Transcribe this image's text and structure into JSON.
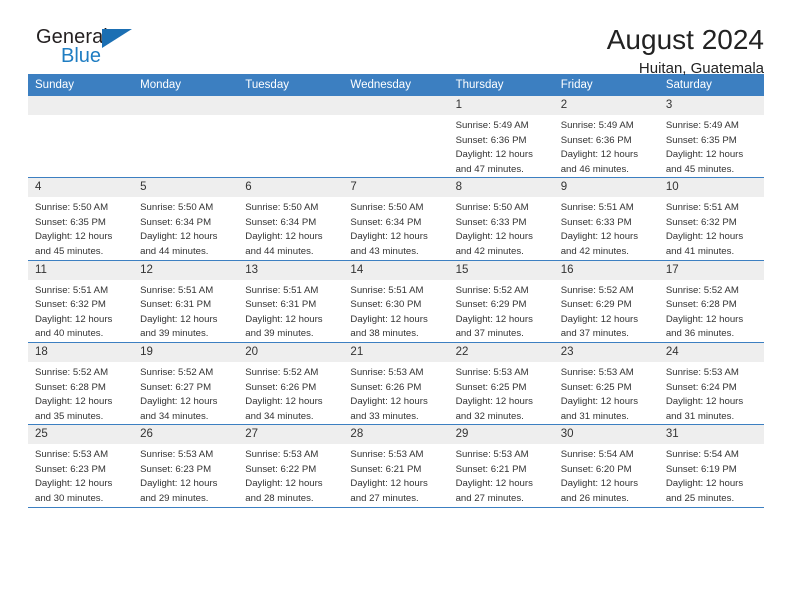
{
  "brand": {
    "word_top": "General",
    "word_bottom": "Blue",
    "triangle_icon": "triangle-logo-icon",
    "color_blue": "#1b6fb3",
    "color_dark": "#231f20"
  },
  "header": {
    "title": "August 2024",
    "subtitle": "Huitan, Guatemala"
  },
  "theme": {
    "header_bar": "#3c7fc1",
    "daynum_bg": "#eeeeee",
    "text": "#333333"
  },
  "weekdays": [
    "Sunday",
    "Monday",
    "Tuesday",
    "Wednesday",
    "Thursday",
    "Friday",
    "Saturday"
  ],
  "labels": {
    "sunrise_prefix": "Sunrise:",
    "sunset_prefix": "Sunset:",
    "daylight_prefix": "Daylight:"
  },
  "weeks": [
    [
      {
        "day": "",
        "empty": true
      },
      {
        "day": "",
        "empty": true
      },
      {
        "day": "",
        "empty": true
      },
      {
        "day": "",
        "empty": true
      },
      {
        "day": "1",
        "sunrise": "Sunrise: 5:49 AM",
        "sunset": "Sunset: 6:36 PM",
        "daylight1": "Daylight: 12 hours",
        "daylight2": "and 47 minutes."
      },
      {
        "day": "2",
        "sunrise": "Sunrise: 5:49 AM",
        "sunset": "Sunset: 6:36 PM",
        "daylight1": "Daylight: 12 hours",
        "daylight2": "and 46 minutes."
      },
      {
        "day": "3",
        "sunrise": "Sunrise: 5:49 AM",
        "sunset": "Sunset: 6:35 PM",
        "daylight1": "Daylight: 12 hours",
        "daylight2": "and 45 minutes."
      }
    ],
    [
      {
        "day": "4",
        "sunrise": "Sunrise: 5:50 AM",
        "sunset": "Sunset: 6:35 PM",
        "daylight1": "Daylight: 12 hours",
        "daylight2": "and 45 minutes."
      },
      {
        "day": "5",
        "sunrise": "Sunrise: 5:50 AM",
        "sunset": "Sunset: 6:34 PM",
        "daylight1": "Daylight: 12 hours",
        "daylight2": "and 44 minutes."
      },
      {
        "day": "6",
        "sunrise": "Sunrise: 5:50 AM",
        "sunset": "Sunset: 6:34 PM",
        "daylight1": "Daylight: 12 hours",
        "daylight2": "and 44 minutes."
      },
      {
        "day": "7",
        "sunrise": "Sunrise: 5:50 AM",
        "sunset": "Sunset: 6:34 PM",
        "daylight1": "Daylight: 12 hours",
        "daylight2": "and 43 minutes."
      },
      {
        "day": "8",
        "sunrise": "Sunrise: 5:50 AM",
        "sunset": "Sunset: 6:33 PM",
        "daylight1": "Daylight: 12 hours",
        "daylight2": "and 42 minutes."
      },
      {
        "day": "9",
        "sunrise": "Sunrise: 5:51 AM",
        "sunset": "Sunset: 6:33 PM",
        "daylight1": "Daylight: 12 hours",
        "daylight2": "and 42 minutes."
      },
      {
        "day": "10",
        "sunrise": "Sunrise: 5:51 AM",
        "sunset": "Sunset: 6:32 PM",
        "daylight1": "Daylight: 12 hours",
        "daylight2": "and 41 minutes."
      }
    ],
    [
      {
        "day": "11",
        "sunrise": "Sunrise: 5:51 AM",
        "sunset": "Sunset: 6:32 PM",
        "daylight1": "Daylight: 12 hours",
        "daylight2": "and 40 minutes."
      },
      {
        "day": "12",
        "sunrise": "Sunrise: 5:51 AM",
        "sunset": "Sunset: 6:31 PM",
        "daylight1": "Daylight: 12 hours",
        "daylight2": "and 39 minutes."
      },
      {
        "day": "13",
        "sunrise": "Sunrise: 5:51 AM",
        "sunset": "Sunset: 6:31 PM",
        "daylight1": "Daylight: 12 hours",
        "daylight2": "and 39 minutes."
      },
      {
        "day": "14",
        "sunrise": "Sunrise: 5:51 AM",
        "sunset": "Sunset: 6:30 PM",
        "daylight1": "Daylight: 12 hours",
        "daylight2": "and 38 minutes."
      },
      {
        "day": "15",
        "sunrise": "Sunrise: 5:52 AM",
        "sunset": "Sunset: 6:29 PM",
        "daylight1": "Daylight: 12 hours",
        "daylight2": "and 37 minutes."
      },
      {
        "day": "16",
        "sunrise": "Sunrise: 5:52 AM",
        "sunset": "Sunset: 6:29 PM",
        "daylight1": "Daylight: 12 hours",
        "daylight2": "and 37 minutes."
      },
      {
        "day": "17",
        "sunrise": "Sunrise: 5:52 AM",
        "sunset": "Sunset: 6:28 PM",
        "daylight1": "Daylight: 12 hours",
        "daylight2": "and 36 minutes."
      }
    ],
    [
      {
        "day": "18",
        "sunrise": "Sunrise: 5:52 AM",
        "sunset": "Sunset: 6:28 PM",
        "daylight1": "Daylight: 12 hours",
        "daylight2": "and 35 minutes."
      },
      {
        "day": "19",
        "sunrise": "Sunrise: 5:52 AM",
        "sunset": "Sunset: 6:27 PM",
        "daylight1": "Daylight: 12 hours",
        "daylight2": "and 34 minutes."
      },
      {
        "day": "20",
        "sunrise": "Sunrise: 5:52 AM",
        "sunset": "Sunset: 6:26 PM",
        "daylight1": "Daylight: 12 hours",
        "daylight2": "and 34 minutes."
      },
      {
        "day": "21",
        "sunrise": "Sunrise: 5:53 AM",
        "sunset": "Sunset: 6:26 PM",
        "daylight1": "Daylight: 12 hours",
        "daylight2": "and 33 minutes."
      },
      {
        "day": "22",
        "sunrise": "Sunrise: 5:53 AM",
        "sunset": "Sunset: 6:25 PM",
        "daylight1": "Daylight: 12 hours",
        "daylight2": "and 32 minutes."
      },
      {
        "day": "23",
        "sunrise": "Sunrise: 5:53 AM",
        "sunset": "Sunset: 6:25 PM",
        "daylight1": "Daylight: 12 hours",
        "daylight2": "and 31 minutes."
      },
      {
        "day": "24",
        "sunrise": "Sunrise: 5:53 AM",
        "sunset": "Sunset: 6:24 PM",
        "daylight1": "Daylight: 12 hours",
        "daylight2": "and 31 minutes."
      }
    ],
    [
      {
        "day": "25",
        "sunrise": "Sunrise: 5:53 AM",
        "sunset": "Sunset: 6:23 PM",
        "daylight1": "Daylight: 12 hours",
        "daylight2": "and 30 minutes."
      },
      {
        "day": "26",
        "sunrise": "Sunrise: 5:53 AM",
        "sunset": "Sunset: 6:23 PM",
        "daylight1": "Daylight: 12 hours",
        "daylight2": "and 29 minutes."
      },
      {
        "day": "27",
        "sunrise": "Sunrise: 5:53 AM",
        "sunset": "Sunset: 6:22 PM",
        "daylight1": "Daylight: 12 hours",
        "daylight2": "and 28 minutes."
      },
      {
        "day": "28",
        "sunrise": "Sunrise: 5:53 AM",
        "sunset": "Sunset: 6:21 PM",
        "daylight1": "Daylight: 12 hours",
        "daylight2": "and 27 minutes."
      },
      {
        "day": "29",
        "sunrise": "Sunrise: 5:53 AM",
        "sunset": "Sunset: 6:21 PM",
        "daylight1": "Daylight: 12 hours",
        "daylight2": "and 27 minutes."
      },
      {
        "day": "30",
        "sunrise": "Sunrise: 5:54 AM",
        "sunset": "Sunset: 6:20 PM",
        "daylight1": "Daylight: 12 hours",
        "daylight2": "and 26 minutes."
      },
      {
        "day": "31",
        "sunrise": "Sunrise: 5:54 AM",
        "sunset": "Sunset: 6:19 PM",
        "daylight1": "Daylight: 12 hours",
        "daylight2": "and 25 minutes."
      }
    ]
  ]
}
